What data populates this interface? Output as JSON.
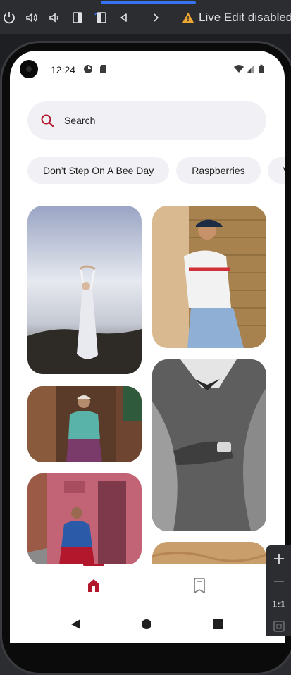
{
  "toolbar": {
    "live_edit_label": "Live Edit disabled"
  },
  "status_bar": {
    "time": "12:24"
  },
  "search": {
    "label": "Search"
  },
  "chips": [
    "Don’t Step On A Bee Day",
    "Raspberries",
    "Vint"
  ],
  "photos": [
    {
      "name": "photo-woman-dress-sunset",
      "alt": "Woman in white dress holding flowers against sky"
    },
    {
      "name": "photo-man-cap-wall",
      "alt": "Man in cap and jersey leaning on wall"
    },
    {
      "name": "photo-elderly-woman-doorway",
      "alt": "Elderly woman in traditional dress at doorway"
    },
    {
      "name": "photo-suit-cufflinks",
      "alt": "Man in suit adjusting cuff, black and white"
    },
    {
      "name": "photo-woman-pink-wall",
      "alt": "Woman in traditional dress by pink wall"
    },
    {
      "name": "photo-sand-texture",
      "alt": "Sandy texture"
    }
  ],
  "side_panel": {
    "zoom_label": "1:1"
  },
  "colors": {
    "accent": "#b3172b",
    "chip_bg": "#f1f1f5"
  }
}
